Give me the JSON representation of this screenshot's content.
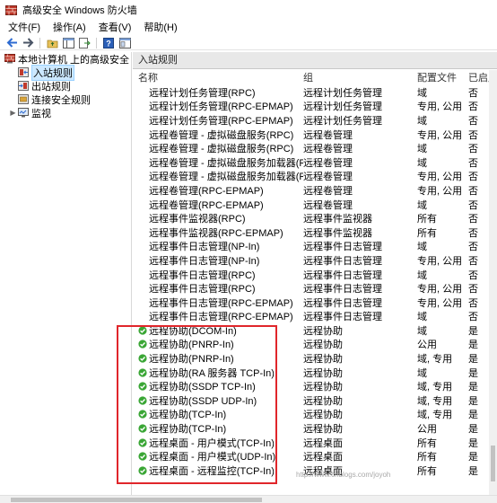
{
  "window": {
    "title": "高级安全 Windows 防火墙"
  },
  "menu": [
    "文件(F)",
    "操作(A)",
    "查看(V)",
    "帮助(H)"
  ],
  "tree": {
    "root": "本地计算机 上的高级安全 Windows",
    "items": [
      "入站规则",
      "出站规则",
      "连接安全规则",
      "监视"
    ]
  },
  "panel": {
    "title": "入站规则",
    "columns": {
      "name": "名称",
      "group": "组",
      "profile": "配置文件",
      "enabled": "已启用"
    }
  },
  "rules": [
    {
      "name": "远程计划任务管理(RPC)",
      "group": "远程计划任务管理",
      "profile": "域",
      "enabled": "否",
      "on": false
    },
    {
      "name": "远程计划任务管理(RPC-EPMAP)",
      "group": "远程计划任务管理",
      "profile": "专用, 公用",
      "enabled": "否",
      "on": false
    },
    {
      "name": "远程计划任务管理(RPC-EPMAP)",
      "group": "远程计划任务管理",
      "profile": "域",
      "enabled": "否",
      "on": false
    },
    {
      "name": "远程卷管理 - 虚拟磁盘服务(RPC)",
      "group": "远程卷管理",
      "profile": "专用, 公用",
      "enabled": "否",
      "on": false
    },
    {
      "name": "远程卷管理 - 虚拟磁盘服务(RPC)",
      "group": "远程卷管理",
      "profile": "域",
      "enabled": "否",
      "on": false
    },
    {
      "name": "远程卷管理 - 虚拟磁盘服务加载器(RPC)",
      "group": "远程卷管理",
      "profile": "域",
      "enabled": "否",
      "on": false
    },
    {
      "name": "远程卷管理 - 虚拟磁盘服务加载器(RPC)",
      "group": "远程卷管理",
      "profile": "专用, 公用",
      "enabled": "否",
      "on": false
    },
    {
      "name": "远程卷管理(RPC-EPMAP)",
      "group": "远程卷管理",
      "profile": "专用, 公用",
      "enabled": "否",
      "on": false
    },
    {
      "name": "远程卷管理(RPC-EPMAP)",
      "group": "远程卷管理",
      "profile": "域",
      "enabled": "否",
      "on": false
    },
    {
      "name": "远程事件监视器(RPC)",
      "group": "远程事件监视器",
      "profile": "所有",
      "enabled": "否",
      "on": false
    },
    {
      "name": "远程事件监视器(RPC-EPMAP)",
      "group": "远程事件监视器",
      "profile": "所有",
      "enabled": "否",
      "on": false
    },
    {
      "name": "远程事件日志管理(NP-In)",
      "group": "远程事件日志管理",
      "profile": "域",
      "enabled": "否",
      "on": false
    },
    {
      "name": "远程事件日志管理(NP-In)",
      "group": "远程事件日志管理",
      "profile": "专用, 公用",
      "enabled": "否",
      "on": false
    },
    {
      "name": "远程事件日志管理(RPC)",
      "group": "远程事件日志管理",
      "profile": "域",
      "enabled": "否",
      "on": false
    },
    {
      "name": "远程事件日志管理(RPC)",
      "group": "远程事件日志管理",
      "profile": "专用, 公用",
      "enabled": "否",
      "on": false
    },
    {
      "name": "远程事件日志管理(RPC-EPMAP)",
      "group": "远程事件日志管理",
      "profile": "专用, 公用",
      "enabled": "否",
      "on": false
    },
    {
      "name": "远程事件日志管理(RPC-EPMAP)",
      "group": "远程事件日志管理",
      "profile": "域",
      "enabled": "否",
      "on": false
    },
    {
      "name": "远程协助(DCOM-In)",
      "group": "远程协助",
      "profile": "域",
      "enabled": "是",
      "on": true
    },
    {
      "name": "远程协助(PNRP-In)",
      "group": "远程协助",
      "profile": "公用",
      "enabled": "是",
      "on": true
    },
    {
      "name": "远程协助(PNRP-In)",
      "group": "远程协助",
      "profile": "域, 专用",
      "enabled": "是",
      "on": true
    },
    {
      "name": "远程协助(RA 服务器 TCP-In)",
      "group": "远程协助",
      "profile": "域",
      "enabled": "是",
      "on": true
    },
    {
      "name": "远程协助(SSDP TCP-In)",
      "group": "远程协助",
      "profile": "域, 专用",
      "enabled": "是",
      "on": true
    },
    {
      "name": "远程协助(SSDP UDP-In)",
      "group": "远程协助",
      "profile": "域, 专用",
      "enabled": "是",
      "on": true
    },
    {
      "name": "远程协助(TCP-In)",
      "group": "远程协助",
      "profile": "域, 专用",
      "enabled": "是",
      "on": true
    },
    {
      "name": "远程协助(TCP-In)",
      "group": "远程协助",
      "profile": "公用",
      "enabled": "是",
      "on": true
    },
    {
      "name": "远程桌面 - 用户模式(TCP-In)",
      "group": "远程桌面",
      "profile": "所有",
      "enabled": "是",
      "on": true
    },
    {
      "name": "远程桌面 - 用户模式(UDP-In)",
      "group": "远程桌面",
      "profile": "所有",
      "enabled": "是",
      "on": true
    },
    {
      "name": "远程桌面 - 远程监控(TCP-In)",
      "group": "远程桌面",
      "profile": "所有",
      "enabled": "是",
      "on": true
    }
  ],
  "watermark": "http://www.cnblogs.com/joyoh",
  "colors": {
    "enabled_icon": "#3aa635",
    "highlight": "#e0262b",
    "selected_bg": "#cce8ff"
  }
}
